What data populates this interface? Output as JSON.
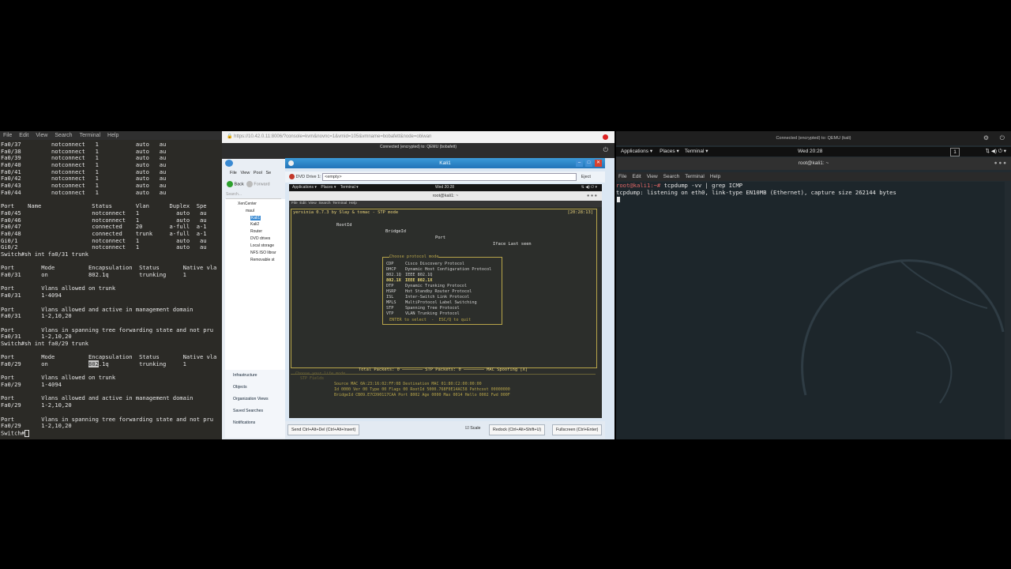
{
  "left_terminal": {
    "menu": [
      "File",
      "Edit",
      "View",
      "Search",
      "Terminal",
      "Help"
    ],
    "lines": [
      "Fa0/37         notconnect   1           auto   au",
      "Fa0/38         notconnect   1           auto   au",
      "Fa0/39         notconnect   1           auto   au",
      "Fa0/40         notconnect   1           auto   au",
      "Fa0/41         notconnect   1           auto   au",
      "Fa0/42         notconnect   1           auto   au",
      "Fa0/43         notconnect   1           auto   au",
      "Fa0/44         notconnect   1           auto   au",
      "",
      "Port    Name               Status       Vlan      Duplex  Spe",
      "Fa0/45                     notconnect   1           auto   au",
      "Fa0/46                     notconnect   1           auto   au",
      "Fa0/47                     connected    20        a-full  a-1",
      "Fa0/48                     connected    trunk     a-full  a-1",
      "Gi0/1                      notconnect   1           auto   au",
      "Gi0/2                      notconnect   1           auto   au",
      "Switch#sh int fa0/31 trunk",
      "",
      "Port        Mode          Encapsulation  Status       Native vla",
      "Fa0/31      on            802.1q         trunking     1",
      "",
      "Port        Vlans allowed on trunk",
      "Fa0/31      1-4094",
      "",
      "Port        Vlans allowed and active in management domain",
      "Fa0/31      1-2,10,20",
      "",
      "Port        Vlans in spanning tree forwarding state and not pru",
      "Fa0/31      1-2,10,20",
      "Switch#sh int fa0/29 trunk",
      "",
      "Port        Mode          Encapsulation  Status       Native vla",
      "Fa0/29      on            802.1q         trunking     1",
      "",
      "Port        Vlans allowed on trunk",
      "Fa0/29      1-4094",
      "",
      "Port        Vlans allowed and active in management domain",
      "Fa0/29      1-2,10,20",
      "",
      "Port        Vlans in spanning tree forwarding state and not pru",
      "Fa0/29      1-2,10,20",
      "Switch#"
    ]
  },
  "browser": {
    "url": "https://10.42.0.11:8006/?console=kvm&novnc=1&vmid=105&vmname=bobafett&node=obiwan",
    "vnc_status": "Connected (encrypted) to: QEMU (bobafett)"
  },
  "xencenter": {
    "menu": [
      "File",
      "View",
      "Pool",
      "Se"
    ],
    "back": "Back",
    "forward": "Forward",
    "search": "Search...",
    "tree": [
      "XenCenter",
      "maul",
      "Kali1",
      "Kali2",
      "Router",
      "DVD drives",
      "Local storage",
      "NFS ISO librar",
      "Removable st"
    ],
    "nav": [
      "Infrastructure",
      "Objects",
      "Organization Views",
      "Saved Searches",
      "Notifications"
    ]
  },
  "kali_vm": {
    "title": "Kali1",
    "dvd_label": "DVD Drive 1:",
    "dvd_value": "<empty>",
    "eject": "Eject",
    "topbar": {
      "apps": "Applications ▾",
      "places": "Places ▾",
      "terminal": "Terminal ▾",
      "clock": "Wed 20:28"
    },
    "term_title": "root@kali1: ~",
    "term_menu": [
      "File",
      "Edit",
      "View",
      "Search",
      "Terminal",
      "Help"
    ],
    "yersinia_header": "yersinia 0.7.3 by Slay & tomac - STP mode",
    "yersinia_time": "[20:28:13]",
    "cols": [
      "RootId",
      "BridgeId",
      "Port",
      "Iface Last seen"
    ],
    "proto_title": "Choose protocol mode",
    "protocols": [
      [
        "CDP",
        "Cisco Discovery Protocol"
      ],
      [
        "DHCP",
        "Dynamic Host Configuration Protocol"
      ],
      [
        "802.1Q",
        "IEEE 802.1Q"
      ],
      [
        "802.1X",
        "IEEE 802.1X"
      ],
      [
        "DTP",
        "Dynamic Trunking Protocol"
      ],
      [
        "HSRP",
        "Hot Standby Router Protocol"
      ],
      [
        "ISL",
        "Inter-Switch Link Protocol"
      ],
      [
        "MPLS",
        "MultiProtocol Label Switching"
      ],
      [
        "STP",
        "Spanning Tree Protocol"
      ],
      [
        "VTP",
        "VLAN Trunking Protocol"
      ]
    ],
    "proto_footer": "ENTER to select  -  ESC/Q to quit",
    "status": "Total Packets: 0 ──────── STP Packets: 0 ──────── MAC Spoofing [X]",
    "fields_title": "STP Fields",
    "fields_hint": "Choose your life mode",
    "fields": [
      "Source MAC 0A:23:16:02:FF:08 Destination MAC 01:80:C2:00:00:00",
      "Id 0000 Ver 00 Type 00 Flags 00 RootId 5000.768F0E14AC58 Pathcost 00000000",
      "BridgeId CB09.E7CD90117CAA Port 8002 Age 0000 Max 0014 Hello 0002 Fwd 000F"
    ],
    "buttons": {
      "cad": "Send Ctrl+Alt+Del (Ctrl+Alt+Insert)",
      "scale": "Scale",
      "redock": "Redock (Ctrl+Alt+Shift+U)",
      "fullscreen": "Fullscreen (Ctrl+Enter)"
    }
  },
  "right_terminal": {
    "vnc_status": "Connected (encrypted) to: QEMU (kali)",
    "topbar": {
      "apps": "Applications ▾",
      "places": "Places ▾",
      "terminal": "Terminal ▾",
      "clock": "Wed 20:28",
      "badge": "1"
    },
    "title": "root@kali1: ~",
    "menu": [
      "File",
      "Edit",
      "View",
      "Search",
      "Terminal",
      "Help"
    ],
    "prompt": "root@kali1:~#",
    "command": " tcpdump -vv | grep ICMP",
    "output": "tcpdump: listening on eth0, link-type EN10MB (Ethernet), capture size 262144 bytes"
  }
}
